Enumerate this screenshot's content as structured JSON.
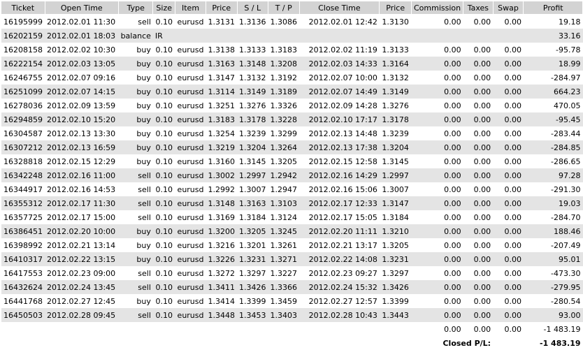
{
  "headers": [
    "Ticket",
    "Open Time",
    "Type",
    "Size",
    "Item",
    "Price",
    "S / L",
    "T / P",
    "Close Time",
    "Price",
    "Commission",
    "Taxes",
    "Swap",
    "Profit"
  ],
  "rows": [
    [
      "16195999",
      "2012.02.01 11:30",
      "sell",
      "0.10",
      "eurusd",
      "1.3131",
      "1.3136",
      "1.3086",
      "2012.02.01 12:42",
      "1.3130",
      "0.00",
      "0.00",
      "0.00",
      "19.18"
    ],
    [
      "16202159",
      "2012.02.01 18:03",
      "balance",
      "IR",
      "",
      "",
      "",
      "",
      "",
      "",
      "",
      "",
      "",
      "33.16"
    ],
    [
      "16208158",
      "2012.02.02 10:30",
      "buy",
      "0.10",
      "eurusd",
      "1.3138",
      "1.3133",
      "1.3183",
      "2012.02.02 11:19",
      "1.3133",
      "0.00",
      "0.00",
      "0.00",
      "-95.78"
    ],
    [
      "16222154",
      "2012.02.03 13:05",
      "buy",
      "0.10",
      "eurusd",
      "1.3163",
      "1.3148",
      "1.3208",
      "2012.02.03 14:33",
      "1.3164",
      "0.00",
      "0.00",
      "0.00",
      "18.99"
    ],
    [
      "16246755",
      "2012.02.07 09:16",
      "buy",
      "0.10",
      "eurusd",
      "1.3147",
      "1.3132",
      "1.3192",
      "2012.02.07 10:00",
      "1.3132",
      "0.00",
      "0.00",
      "0.00",
      "-284.97"
    ],
    [
      "16251099",
      "2012.02.07 14:15",
      "buy",
      "0.10",
      "eurusd",
      "1.3114",
      "1.3149",
      "1.3189",
      "2012.02.07 14:49",
      "1.3149",
      "0.00",
      "0.00",
      "0.00",
      "664.23"
    ],
    [
      "16278036",
      "2012.02.09 13:59",
      "buy",
      "0.10",
      "eurusd",
      "1.3251",
      "1.3276",
      "1.3326",
      "2012.02.09 14:28",
      "1.3276",
      "0.00",
      "0.00",
      "0.00",
      "470.05"
    ],
    [
      "16294859",
      "2012.02.10 15:20",
      "buy",
      "0.10",
      "eurusd",
      "1.3183",
      "1.3178",
      "1.3228",
      "2012.02.10 17:17",
      "1.3178",
      "0.00",
      "0.00",
      "0.00",
      "-95.45"
    ],
    [
      "16304587",
      "2012.02.13 13:30",
      "buy",
      "0.10",
      "eurusd",
      "1.3254",
      "1.3239",
      "1.3299",
      "2012.02.13 14:48",
      "1.3239",
      "0.00",
      "0.00",
      "0.00",
      "-283.44"
    ],
    [
      "16307212",
      "2012.02.13 16:59",
      "buy",
      "0.10",
      "eurusd",
      "1.3219",
      "1.3204",
      "1.3264",
      "2012.02.13 17:38",
      "1.3204",
      "0.00",
      "0.00",
      "0.00",
      "-284.85"
    ],
    [
      "16328818",
      "2012.02.15 12:29",
      "buy",
      "0.10",
      "eurusd",
      "1.3160",
      "1.3145",
      "1.3205",
      "2012.02.15 12:58",
      "1.3145",
      "0.00",
      "0.00",
      "0.00",
      "-286.65"
    ],
    [
      "16342248",
      "2012.02.16 11:00",
      "sell",
      "0.10",
      "eurusd",
      "1.3002",
      "1.2997",
      "1.2942",
      "2012.02.16 14:29",
      "1.2997",
      "0.00",
      "0.00",
      "0.00",
      "97.28"
    ],
    [
      "16344917",
      "2012.02.16 14:53",
      "sell",
      "0.10",
      "eurusd",
      "1.2992",
      "1.3007",
      "1.2947",
      "2012.02.16 15:06",
      "1.3007",
      "0.00",
      "0.00",
      "0.00",
      "-291.30"
    ],
    [
      "16355312",
      "2012.02.17 11:30",
      "sell",
      "0.10",
      "eurusd",
      "1.3148",
      "1.3163",
      "1.3103",
      "2012.02.17 12:33",
      "1.3147",
      "0.00",
      "0.00",
      "0.00",
      "19.03"
    ],
    [
      "16357725",
      "2012.02.17 15:00",
      "sell",
      "0.10",
      "eurusd",
      "1.3169",
      "1.3184",
      "1.3124",
      "2012.02.17 15:05",
      "1.3184",
      "0.00",
      "0.00",
      "0.00",
      "-284.70"
    ],
    [
      "16386451",
      "2012.02.20 10:00",
      "buy",
      "0.10",
      "eurusd",
      "1.3200",
      "1.3205",
      "1.3245",
      "2012.02.20 11:11",
      "1.3210",
      "0.00",
      "0.00",
      "0.00",
      "188.46"
    ],
    [
      "16398992",
      "2012.02.21 13:14",
      "buy",
      "0.10",
      "eurusd",
      "1.3216",
      "1.3201",
      "1.3261",
      "2012.02.21 13:17",
      "1.3205",
      "0.00",
      "0.00",
      "0.00",
      "-207.49"
    ],
    [
      "16410317",
      "2012.02.22 13:15",
      "buy",
      "0.10",
      "eurusd",
      "1.3226",
      "1.3231",
      "1.3271",
      "2012.02.22 14:08",
      "1.3231",
      "0.00",
      "0.00",
      "0.00",
      "95.01"
    ],
    [
      "16417553",
      "2012.02.23 09:00",
      "sell",
      "0.10",
      "eurusd",
      "1.3272",
      "1.3297",
      "1.3227",
      "2012.02.23 09:27",
      "1.3297",
      "0.00",
      "0.00",
      "0.00",
      "-473.30"
    ],
    [
      "16432624",
      "2012.02.24 13:45",
      "sell",
      "0.10",
      "eurusd",
      "1.3411",
      "1.3426",
      "1.3366",
      "2012.02.24 15:32",
      "1.3426",
      "0.00",
      "0.00",
      "0.00",
      "-279.95"
    ],
    [
      "16441768",
      "2012.02.27 12:45",
      "buy",
      "0.10",
      "eurusd",
      "1.3414",
      "1.3399",
      "1.3459",
      "2012.02.27 12:57",
      "1.3399",
      "0.00",
      "0.00",
      "0.00",
      "-280.54"
    ],
    [
      "16450503",
      "2012.02.28 09:45",
      "sell",
      "0.10",
      "eurusd",
      "1.3448",
      "1.3453",
      "1.3403",
      "2012.02.28 10:43",
      "1.3443",
      "0.00",
      "0.00",
      "0.00",
      "93.00"
    ]
  ],
  "totals": {
    "commission": "0.00",
    "taxes": "0.00",
    "swap": "0.00",
    "profit": "-1 483.19"
  },
  "closed": {
    "label": "Closed P/L:",
    "value": "-1 483.19"
  }
}
